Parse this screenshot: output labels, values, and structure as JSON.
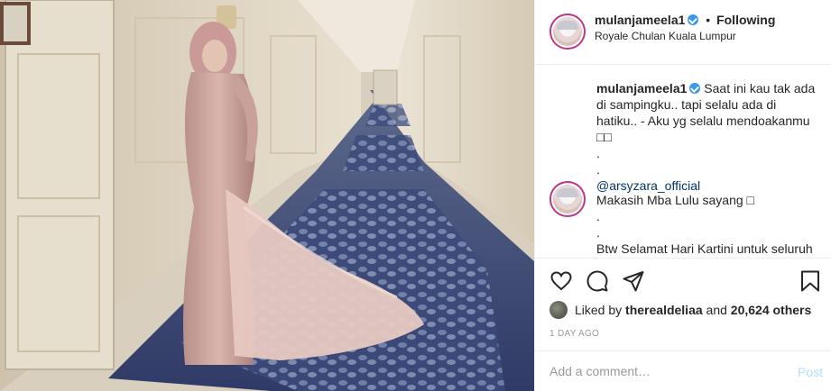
{
  "header": {
    "username": "mulanjameela1",
    "separator": "•",
    "follow_status": "Following",
    "location": "Royale Chulan Kuala Lumpur"
  },
  "caption": {
    "username": "mulanjameela1",
    "lines": [
      "Saat ini kau tak ada",
      "di sampingku.. tapi selalu ada di",
      "hatiku.. - Aku yg selalu mendoakanmu",
      "□□",
      ".",
      ".",
      "@arsyzara_official"
    ]
  },
  "reply": {
    "lines": [
      "Makasih Mba Lulu sayang □",
      ".",
      ".",
      "Btw Selamat Hari Kartini untuk seluruh"
    ]
  },
  "likes": {
    "prefix": "Liked by",
    "liker": "therealdeliaa",
    "middle": "and",
    "others": "20,624 others"
  },
  "timestamp": "1 DAY AGO",
  "comment_box": {
    "placeholder": "Add a comment…",
    "post_label": "Post"
  },
  "icons": {
    "like": "heart-icon",
    "comment": "comment-icon",
    "share": "share-icon",
    "save": "bookmark-icon"
  },
  "colors": {
    "verified": "#3897f0",
    "mention": "#003569",
    "post_disabled": "#b2dffc"
  }
}
